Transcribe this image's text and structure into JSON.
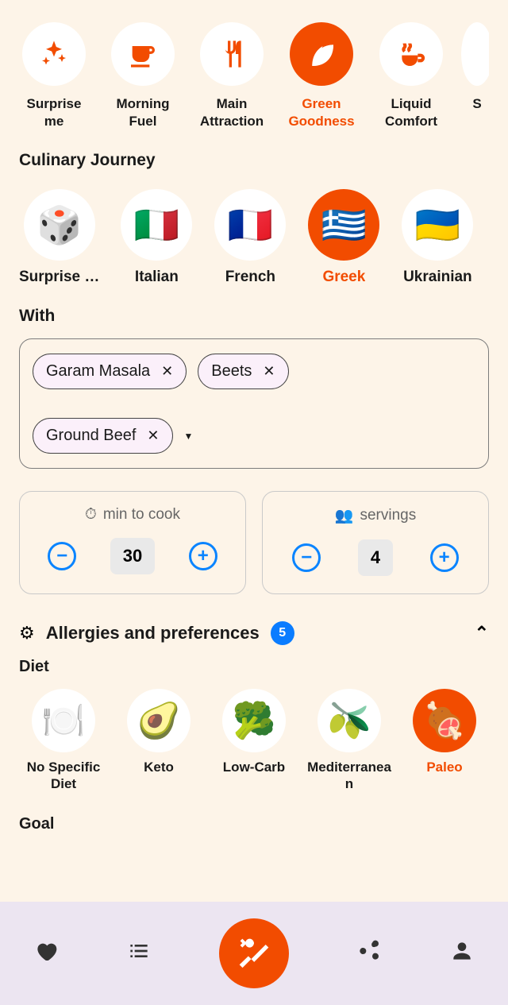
{
  "meal_types": [
    {
      "id": "surprise",
      "label": "Surprise me",
      "active": false,
      "icon": "sparkle"
    },
    {
      "id": "morning",
      "label": "Morning Fuel",
      "active": false,
      "icon": "cup"
    },
    {
      "id": "main",
      "label": "Main Attraction",
      "active": false,
      "icon": "fork-knife"
    },
    {
      "id": "green",
      "label": "Green Goodness",
      "active": true,
      "icon": "leaf"
    },
    {
      "id": "liquid",
      "label": "Liquid Comfort",
      "active": false,
      "icon": "ladle"
    },
    {
      "id": "extra",
      "label": "S",
      "active": false,
      "icon": "blank"
    }
  ],
  "section_culinary": "Culinary Journey",
  "cuisines": [
    {
      "id": "surprise",
      "label": "Surprise …",
      "emoji": "🎲",
      "active": false
    },
    {
      "id": "italian",
      "label": "Italian",
      "emoji": "🇮🇹",
      "active": false
    },
    {
      "id": "french",
      "label": "French",
      "emoji": "🇫🇷",
      "active": false
    },
    {
      "id": "greek",
      "label": "Greek",
      "emoji": "🇬🇷",
      "active": true
    },
    {
      "id": "ukrainian",
      "label": "Ukrainian",
      "emoji": "🇺🇦",
      "active": false
    }
  ],
  "section_with": "With",
  "with_items": [
    "Garam Masala",
    "Beets",
    "Ground Beef"
  ],
  "steppers": {
    "cook": {
      "label": "min to cook",
      "value": "30"
    },
    "servings": {
      "label": "servings",
      "value": "4"
    }
  },
  "prefs": {
    "title": "Allergies and preferences",
    "badge": "5"
  },
  "section_diet": "Diet",
  "diets": [
    {
      "id": "none",
      "label": "No Specific Diet",
      "emoji": "🍽️",
      "active": false
    },
    {
      "id": "keto",
      "label": "Keto",
      "emoji": "🥑",
      "active": false
    },
    {
      "id": "lowcarb",
      "label": "Low-Carb",
      "emoji": "🥦",
      "active": false
    },
    {
      "id": "med",
      "label": "Mediterranean",
      "emoji": "🫒",
      "active": false
    },
    {
      "id": "paleo",
      "label": "Paleo",
      "emoji": "🍖",
      "active": true
    }
  ],
  "section_goal": "Goal"
}
